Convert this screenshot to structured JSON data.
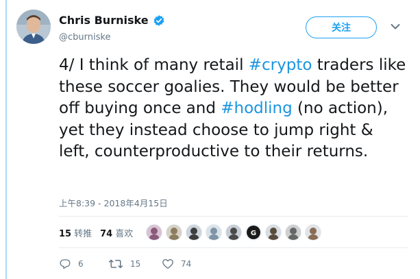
{
  "author": {
    "name": "Chris Burniske",
    "handle": "@cburniske",
    "verified": true
  },
  "follow_button": {
    "label": "关注"
  },
  "tweet": {
    "segments": [
      {
        "text": "4/ I think of many retail ",
        "type": "text"
      },
      {
        "text": "#crypto",
        "type": "hashtag"
      },
      {
        "text": " traders like these soccer goalies. They would be better off buying once and ",
        "type": "text"
      },
      {
        "text": "#hodling",
        "type": "hashtag"
      },
      {
        "text": " (no action), yet they instead choose to jump right & left, counterproductive to their returns.",
        "type": "text"
      }
    ],
    "timestamp": "上午8:39 - 2018年4月15日"
  },
  "stats": {
    "retweets_count": "15",
    "retweets_label": "转推",
    "likes_count": "74",
    "likes_label": "喜欢"
  },
  "likers": [
    "liker-1",
    "liker-2",
    "liker-3",
    "liker-4",
    "liker-5",
    "liker-6",
    "liker-7",
    "liker-8",
    "liker-9"
  ],
  "actions": {
    "reply_count": "6",
    "retweet_count": "15",
    "like_count": "74"
  },
  "colors": {
    "accent": "#1da1f2",
    "hashtag": "#1b95e0",
    "muted": "#657786"
  }
}
